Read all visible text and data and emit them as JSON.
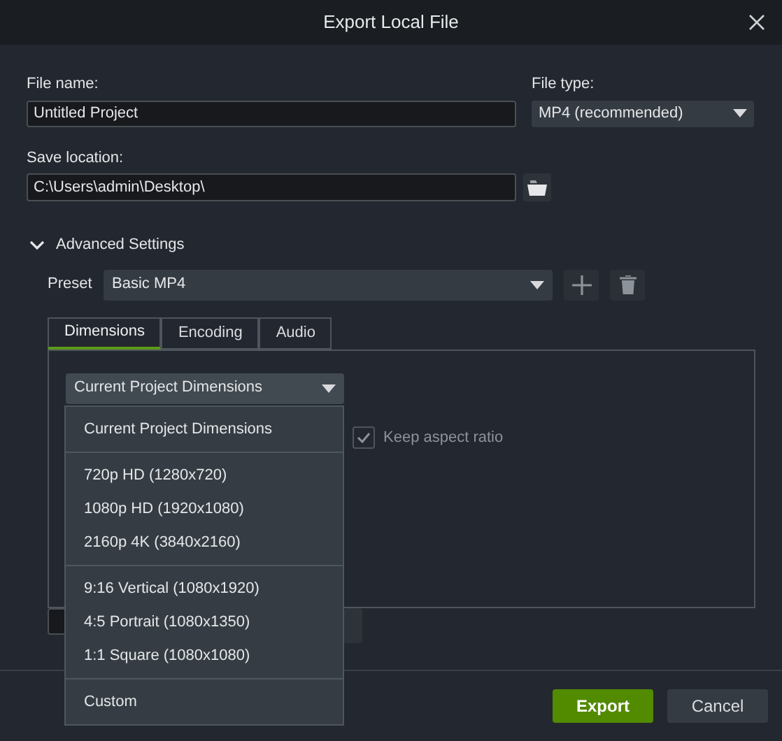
{
  "window": {
    "title": "Export Local File"
  },
  "file_name": {
    "label": "File name:",
    "value": "Untitled Project"
  },
  "file_type": {
    "label": "File type:",
    "value": "MP4 (recommended)"
  },
  "save_location": {
    "label": "Save location:",
    "value": "C:\\Users\\admin\\Desktop\\"
  },
  "advanced": {
    "label": "Advanced Settings",
    "expanded": true
  },
  "preset": {
    "label": "Preset",
    "value": "Basic MP4"
  },
  "tabs": [
    {
      "label": "Dimensions",
      "selected": true
    },
    {
      "label": "Encoding",
      "selected": false
    },
    {
      "label": "Audio",
      "selected": false
    }
  ],
  "dimensions": {
    "value": "Current Project Dimensions",
    "keep_aspect": {
      "label": "Keep aspect ratio",
      "checked": true
    }
  },
  "menu_groups": [
    [
      "Current Project Dimensions"
    ],
    [
      "720p HD (1280x720)",
      "1080p HD (1920x1080)",
      "2160p 4K (3840x2160)"
    ],
    [
      "9:16 Vertical (1080x1920)",
      "4:5 Portrait (1080x1350)",
      "1:1 Square (1080x1080)"
    ],
    [
      "Custom"
    ]
  ],
  "buttons": [
    {
      "label": "Export",
      "kind": "primary"
    },
    {
      "label": "Cancel",
      "kind": "secondary"
    }
  ]
}
